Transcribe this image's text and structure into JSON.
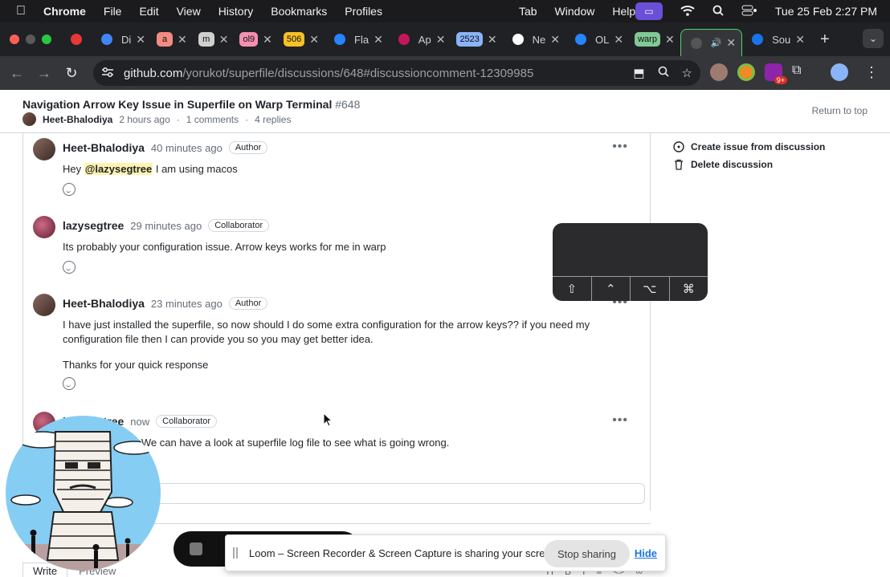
{
  "menubar": {
    "app": "Chrome",
    "items": [
      "File",
      "Edit",
      "View",
      "History",
      "Bookmarks",
      "Profiles",
      "Tab",
      "Window",
      "Help"
    ],
    "datetime": "Tue 25 Feb  2:27 PM"
  },
  "tabs": [
    {
      "icon": "recording-icon",
      "label": "",
      "fav_text": "",
      "color": "#e53935"
    },
    {
      "icon": "chrome-icon",
      "label": "Di",
      "fav_text": "",
      "color": "#4285f4"
    },
    {
      "icon": "letter-a-icon",
      "label": "",
      "fav_text": "a",
      "color": "#f28b82"
    },
    {
      "icon": "letter-m-icon",
      "label": "",
      "fav_text": "m",
      "color": "#cfcfcf"
    },
    {
      "icon": "ol9-icon",
      "label": "",
      "fav_text": "ol9",
      "color": "#f48fb1"
    },
    {
      "icon": "506-icon",
      "label": "",
      "fav_text": "506",
      "color": "#f6c026"
    },
    {
      "icon": "confluence-icon",
      "label": "Fla",
      "fav_text": "",
      "color": "#2684ff"
    },
    {
      "icon": "app-icon",
      "label": "Ap",
      "fav_text": "",
      "color": "#c2185b"
    },
    {
      "icon": "2523-icon",
      "label": "",
      "fav_text": "2523",
      "color": "#8ab4f8"
    },
    {
      "icon": "github-icon",
      "label": "Ne",
      "fav_text": "",
      "color": "#ffffff"
    },
    {
      "icon": "confluence-icon",
      "label": "OL",
      "fav_text": "",
      "color": "#2684ff"
    },
    {
      "icon": "warp-icon",
      "label": "",
      "fav_text": "warp",
      "color": "#81c995"
    },
    {
      "icon": "github-icon",
      "label": "",
      "fav_text": "",
      "color": "#555555",
      "active": true
    },
    {
      "icon": "shield-icon",
      "label": "Sou",
      "fav_text": "",
      "color": "#1a73e8"
    }
  ],
  "address": {
    "domain": "github.com",
    "path": "/yorukot/superfile/discussions/648#discussioncomment-12309985"
  },
  "discussion": {
    "title": "Navigation Arrow Key Issue in Superfile on Warp Terminal",
    "number": "#648",
    "author": "Heet-Bhalodiya",
    "time": "2 hours ago",
    "comments": "1 comments",
    "replies": "4 replies",
    "return_to_top": "Return to top"
  },
  "comments": [
    {
      "author": "Heet-Bhalodiya",
      "time": "40 minutes ago",
      "role": "Author",
      "mention": "@lazysegtree",
      "body_before": "Hey ",
      "body_after": " I am using macos",
      "paragraphs": []
    },
    {
      "author": "lazysegtree",
      "time": "29 minutes ago",
      "role": "Collaborator",
      "paragraphs": [
        "Its probably your configuration issue. Arrow keys works for me in warp"
      ]
    },
    {
      "author": "Heet-Bhalodiya",
      "time": "23 minutes ago",
      "role": "Author",
      "paragraphs": [
        "I have just installed the superfile, so now should I do some extra configuration for the arrow keys?? if you need my configuration file then I can provide you so you may get better idea.",
        "Thanks for your quick response"
      ]
    },
    {
      "author": "lazysegtree",
      "time": "now",
      "role": "Collaborator",
      "paragraphs": [
        "I've noticed that. We can have a look at superfile log file to see what is going wrong."
      ]
    }
  ],
  "sidebar": {
    "create_issue": "Create issue from discussion",
    "delete": "Delete discussion"
  },
  "keyhud": {
    "keys": [
      "⇧",
      "⌃",
      "⌥",
      "⌘"
    ]
  },
  "editor": {
    "write": "Write",
    "preview": "Preview"
  },
  "share_bar": {
    "message": "Loom – Screen Recorder & Screen Capture is sharing your screen.",
    "stop": "Stop sharing",
    "hide": "Hide"
  },
  "colors": {
    "menubar_bg": "#1b1b1d",
    "tabbar_bg": "#202124",
    "toolbar_bg": "#35363a",
    "mention_bg": "#fff3b0",
    "link_blue": "#1a73e8"
  }
}
